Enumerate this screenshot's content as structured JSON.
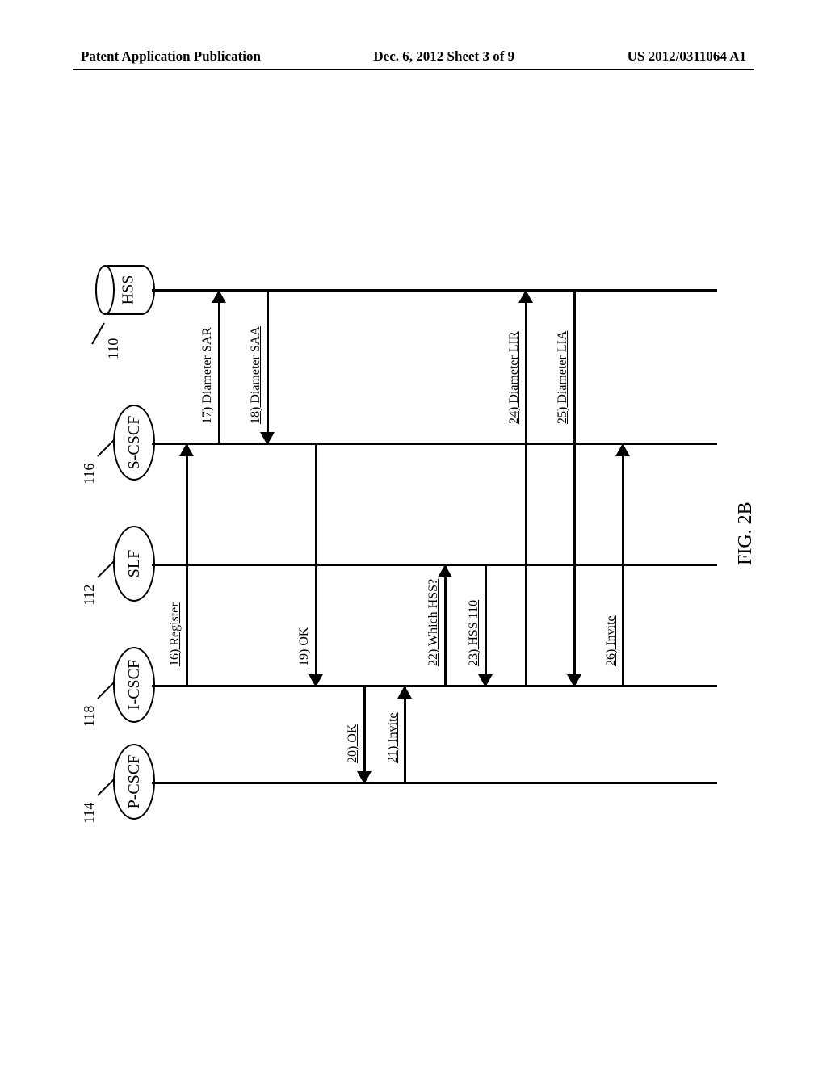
{
  "header": {
    "left": "Patent Application Publication",
    "center": "Dec. 6, 2012  Sheet 3 of 9",
    "right": "US 2012/0311064 A1"
  },
  "nodes": {
    "pcscf": {
      "label": "P-CSCF",
      "ref": "114"
    },
    "icscf": {
      "label": "I-CSCF",
      "ref": "118"
    },
    "slf": {
      "label": "SLF",
      "ref": "112"
    },
    "scscf": {
      "label": "S-CSCF",
      "ref": "116"
    },
    "hss": {
      "label": "HSS",
      "ref": "110"
    }
  },
  "messages": {
    "m16": "16) Register",
    "m17": "17) Diameter SAR",
    "m18": "18) Diameter SAA",
    "m19": "19) OK",
    "m20": "20) OK",
    "m21": "21) Invite",
    "m22": "22) Which HSS?",
    "m23": "23) HSS 110",
    "m24": "24) Diameter LIR",
    "m25": "25) Diameter LIA",
    "m26": "26) Invite"
  },
  "figure_label": "FIG. 2B",
  "chart_data": {
    "type": "sequence_diagram",
    "participants": [
      "P-CSCF",
      "I-CSCF",
      "SLF",
      "S-CSCF",
      "HSS"
    ],
    "participant_refs": {
      "P-CSCF": "114",
      "I-CSCF": "118",
      "SLF": "112",
      "S-CSCF": "116",
      "HSS": "110"
    },
    "messages": [
      {
        "from": "I-CSCF",
        "to": "S-CSCF",
        "label": "16) Register"
      },
      {
        "from": "S-CSCF",
        "to": "HSS",
        "label": "17) Diameter SAR"
      },
      {
        "from": "HSS",
        "to": "S-CSCF",
        "label": "18) Diameter SAA"
      },
      {
        "from": "S-CSCF",
        "to": "I-CSCF",
        "label": "19) OK"
      },
      {
        "from": "I-CSCF",
        "to": "P-CSCF",
        "label": "20) OK"
      },
      {
        "from": "P-CSCF",
        "to": "I-CSCF",
        "label": "21) Invite"
      },
      {
        "from": "I-CSCF",
        "to": "SLF",
        "label": "22) Which HSS?"
      },
      {
        "from": "SLF",
        "to": "I-CSCF",
        "label": "23) HSS 110"
      },
      {
        "from": "I-CSCF",
        "to": "HSS",
        "label": "24) Diameter LIR"
      },
      {
        "from": "HSS",
        "to": "I-CSCF",
        "label": "25) Diameter LIA"
      },
      {
        "from": "I-CSCF",
        "to": "S-CSCF",
        "label": "26) Invite"
      }
    ],
    "figure": "FIG. 2B"
  }
}
